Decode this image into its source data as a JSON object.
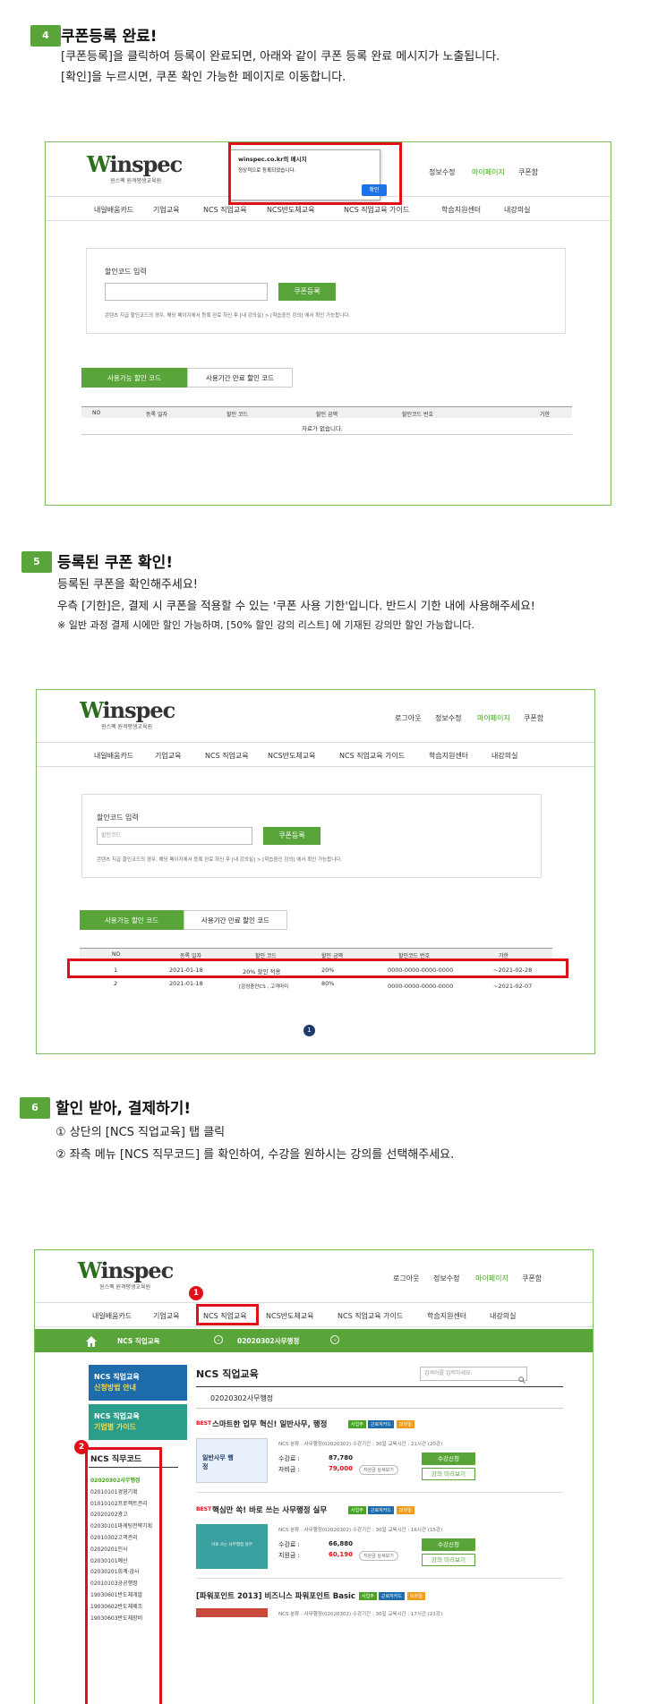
{
  "step4": {
    "num": "4",
    "title": "쿠폰등록 완료!",
    "lines": [
      "[쿠폰등록]을 클릭하여 등록이 완료되면, 아래와 같이 쿠폰 등록 완료 메시지가 노출됩니다.",
      "[확인]을 누르시면, 쿠폰 확인 가능한 페이지로 이동합니다."
    ]
  },
  "step5": {
    "num": "5",
    "title": "등록된 쿠폰 확인!",
    "lines": [
      "등록된 쿠폰을 확인해주세요!",
      "우측 [기한]은, 결제 시 쿠폰을 적용할 수 있는 '쿠폰 사용 기한'입니다. 반드시 기한 내에 사용해주세요!",
      "※ 일반 과정 결제 시에만 할인 가능하며, [50% 할인 강의 리스트] 에 기재된 강의만 할인 가능합니다."
    ]
  },
  "step6": {
    "num": "6",
    "title": "할인 받아, 결제하기!",
    "lines": [
      "① 상단의 [NCS 직업교육] 탭 클릭",
      "② 좌측 메뉴 [NCS 직무코드] 를 확인하여, 수강을 원하시는 강의를 선택해주세요."
    ]
  },
  "site": {
    "logo_w": "W",
    "logo_rest": "inspec",
    "logo_sub": "윈스펙 원격평생교육원",
    "top_links": [
      "로그아웃",
      "정보수정",
      "마이페이지",
      "쿠폰함"
    ],
    "nav": [
      "내일배움카드",
      "기업교육",
      "NCS 직업교육",
      "NCS반도체교육",
      "NCS 직업교육 가이드",
      "학습지원센터",
      "내강의실"
    ]
  },
  "coupon": {
    "label": "할인코드 입력",
    "placeholder": "할인코드",
    "button": "쿠폰등록",
    "note": "콘텐츠 지급 할인코드의 경우, 해당 페이지에서 등록 완료 하신 후 [내 강의실] > [학습중인 강의] 에서 확인 가능합니다.",
    "tab_on": "사용가능 할인 코드",
    "tab_off": "사용기간 만료 할인 코드",
    "headers": [
      "NO",
      "등록 일자",
      "할인 코드",
      "할인 금액",
      "할인코드 번호",
      "기한"
    ],
    "empty": "자료가 없습니다.",
    "rows": [
      [
        "1",
        "2021-01-18",
        "20% 할인 적용",
        "20%",
        "0000-0000-0000-0000",
        "~2021-02-28"
      ],
      [
        "2",
        "2021-01-18",
        "[감성충만CS , 고객마미",
        "80%",
        "0000-0000-0000-0000",
        "~2021-02-07"
      ]
    ],
    "page": "1"
  },
  "dialog": {
    "title": "winspec.co.kr의 메시지",
    "message": "정상적으로 등록되었습니다.",
    "ok": "확인"
  },
  "ncs": {
    "bar_item1": "NCS 직업교육",
    "bar_item2": "02020302사무행정",
    "title": "NCS 직업교육",
    "search_placeholder": "검색어를 입력하세요.",
    "sub": "02020302사무행정",
    "banner1": [
      "NCS 직업교육",
      "신청방법 안내"
    ],
    "banner2": [
      "NCS 직업교육",
      "기업별 가이드"
    ],
    "side_title": "NCS 직무코드",
    "codes": [
      "02020302사무행정",
      "02010101경영기획",
      "01010102프로젝트관리",
      "02020202광고",
      "02030101마케팅전략기획",
      "02010302고객관리",
      "02020201인사",
      "02030101예산",
      "02030201회계·감사",
      "02010103공공행정",
      "19030601반도체개발",
      "19030602반도체제조",
      "19030603반도체장비"
    ],
    "badge1": "1",
    "badge2": "2",
    "courses": [
      {
        "best": "BEST",
        "title": "스마트한 업무 혁신! 일반사무, 행정",
        "tags": [
          "사업주",
          "근로자카드",
          "모바일"
        ],
        "meta": "NCS 분류 : 사무행정(02020302)   수강기간 : 30일   교육시간 : 21시간 (20강)",
        "thumb": "일반사무 행정",
        "price_label": "수강료 :",
        "price": "87,780",
        "support_label": "자비금 :",
        "support": "79,000",
        "pill": "자원금 상세보기",
        "btn1": "수강신청",
        "btn2": "강의 미리보기"
      },
      {
        "best": "BEST",
        "title": "핵심만 쏙! 바로 쓰는 사무행정 실무",
        "tags": [
          "사업주",
          "근로자카드",
          "모바일"
        ],
        "meta": "NCS 분류 : 사무행정(02020302)   수강기간 : 30일   교육시간 : 16시간 (15강)",
        "thumb": "바로 쓰는 사무행정 실무",
        "price_label": "수강료 :",
        "price": "66,880",
        "support_label": "지원금 :",
        "support": "60,190",
        "pill": "지원금 상세보기",
        "btn1": "수강신청",
        "btn2": "강의 미리보기"
      },
      {
        "best": "",
        "title": "[파워포인트 2013] 비즈니스 파워포인트 Basic",
        "tags": [
          "사업주",
          "근로자카드",
          "모바일"
        ],
        "meta": "NCS 분류 : 사무행정(02020302)   수강기간 : 30일   교육시간 : 17시간 (21강)"
      }
    ]
  },
  "colors": {
    "green": "#5aa53a",
    "red": "#e0101b"
  }
}
